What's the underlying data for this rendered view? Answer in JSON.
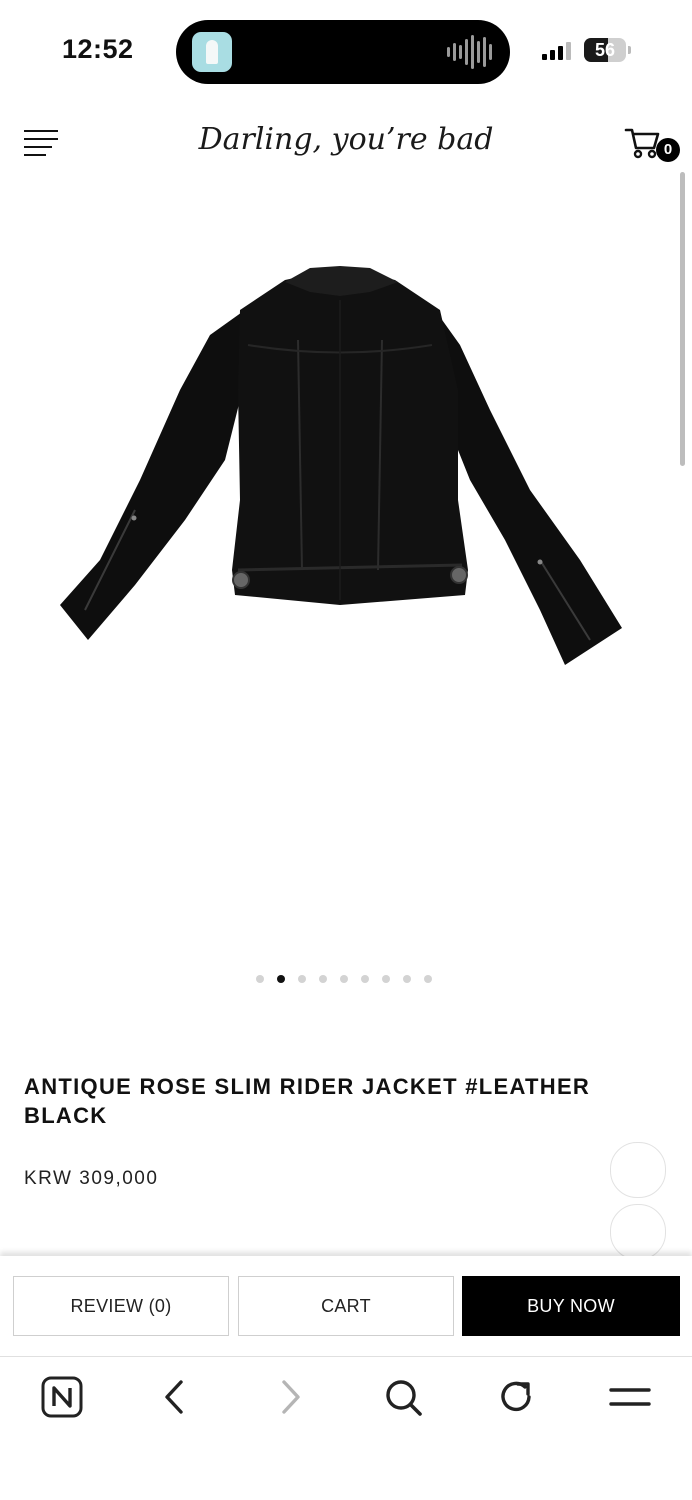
{
  "status_bar": {
    "time": "12:52",
    "battery_level": "56",
    "battery_fraction": 0.56,
    "signal_bars": 3,
    "island_app_icon": "app-thumbnail-icon",
    "island_activity_icon": "audio-waveform-icon"
  },
  "header": {
    "site_title": "Darling, you’re bad",
    "menu_icon": "hamburger-menu-icon",
    "cart_icon": "shopping-cart-icon",
    "cart_count": "0"
  },
  "gallery": {
    "image_name": "black-leather-jacket-back-view",
    "slide_count": 9,
    "active_slide": 2
  },
  "product": {
    "name": "ANTIQUE ROSE SLIM RIDER JACKET #LEATHER BLACK",
    "price": "KRW 309,000"
  },
  "actions": {
    "review_label": "REVIEW (0)",
    "cart_label": "CART",
    "buy_now_label": "BUY NOW"
  },
  "browser_toolbar": {
    "icons": [
      "naver-home-icon",
      "back-arrow-icon",
      "forward-arrow-icon",
      "search-icon",
      "reload-icon",
      "menu-icon"
    ]
  },
  "colors": {
    "accent": "#000000",
    "background": "#ffffff",
    "border": "#cfcfcf",
    "dot_inactive": "#d3d3d3"
  }
}
